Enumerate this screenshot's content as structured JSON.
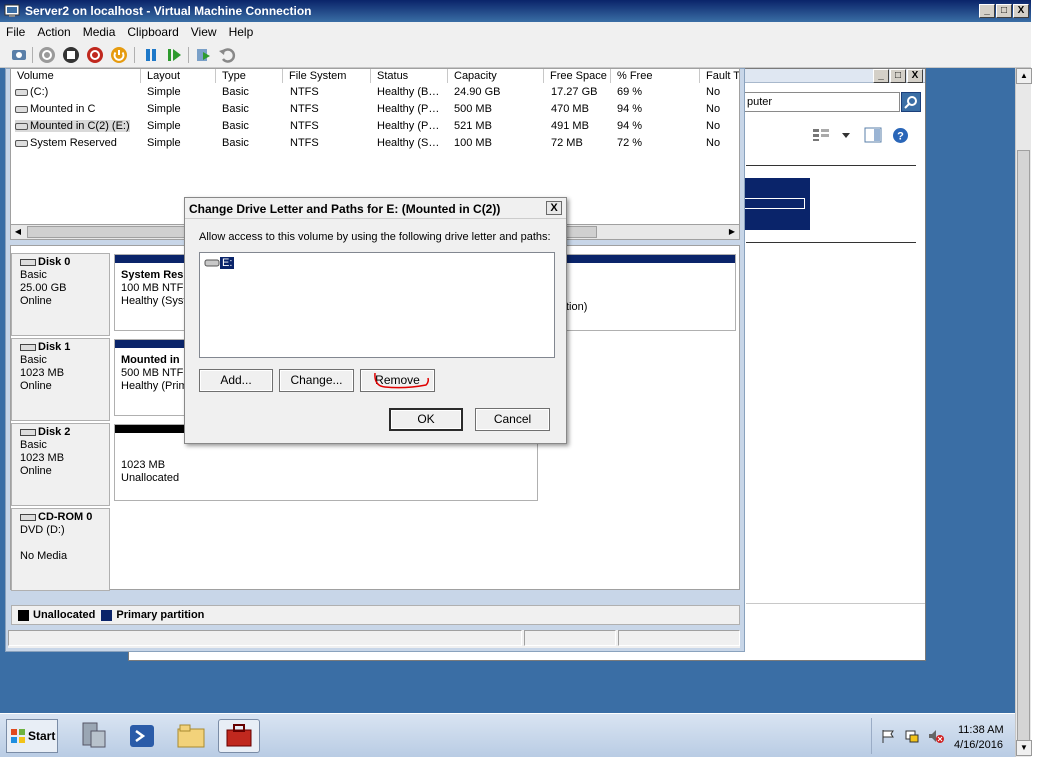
{
  "vm_window": {
    "title": "Server2 on localhost - Virtual Machine Connection",
    "menu": [
      "File",
      "Action",
      "Media",
      "Clipboard",
      "View",
      "Help"
    ],
    "caption_buttons": [
      "_",
      "□",
      "X"
    ]
  },
  "volume_list": {
    "columns": [
      "Volume",
      "Layout",
      "Type",
      "File System",
      "Status",
      "Capacity",
      "Free Space",
      "% Free",
      "Fault T"
    ],
    "rows": [
      [
        "(C:)",
        "Simple",
        "Basic",
        "NTFS",
        "Healthy (B…",
        "24.90 GB",
        "17.27 GB",
        "69 %",
        "No"
      ],
      [
        "Mounted in C",
        "Simple",
        "Basic",
        "NTFS",
        "Healthy (P…",
        "500 MB",
        "470 MB",
        "94 %",
        "No"
      ],
      [
        "Mounted in C(2) (E:)",
        "Simple",
        "Basic",
        "NTFS",
        "Healthy (P…",
        "521 MB",
        "491 MB",
        "94 %",
        "No"
      ],
      [
        "System Reserved",
        "Simple",
        "Basic",
        "NTFS",
        "Healthy (S…",
        "100 MB",
        "72 MB",
        "72 %",
        "No"
      ]
    ]
  },
  "disks": [
    {
      "name": "Disk 0",
      "type": "Basic",
      "size": "25.00 GB",
      "state": "Online",
      "partition_name": "System Res",
      "partition_size": "100 MB NTFS",
      "partition_status": "Healthy (Syst",
      "right_text": "tion)"
    },
    {
      "name": "Disk 1",
      "type": "Basic",
      "size": "1023 MB",
      "state": "Online",
      "partition_name": "Mounted in",
      "partition_size": "500 MB NTFS",
      "partition_status": "Healthy (Prim"
    },
    {
      "name": "Disk 2",
      "type": "Basic",
      "size": "1023 MB",
      "state": "Online",
      "partition_size": "1023 MB",
      "partition_status": "Unallocated"
    },
    {
      "name": "CD-ROM 0",
      "type": "DVD (D:)",
      "state": "No Media"
    }
  ],
  "legend": {
    "unallocated": "Unallocated",
    "primary": "Primary partition"
  },
  "cm_window": {
    "search_text": "puter",
    "caption_buttons": [
      "_",
      "□",
      "X"
    ]
  },
  "dialog": {
    "title": "Change Drive Letter and Paths for E: (Mounted in C(2))",
    "description": "Allow access to this volume by using the following drive letter and paths:",
    "list_items": [
      "E:"
    ],
    "buttons": {
      "add": "Add...",
      "change": "Change...",
      "remove": "Remove",
      "ok": "OK",
      "cancel": "Cancel"
    },
    "close": "X"
  },
  "taskbar": {
    "start": "Start",
    "time": "11:38 AM",
    "date": "4/16/2016"
  },
  "colors": {
    "primary_partition": "#0a246a",
    "unallocated": "#000000",
    "annotation": "#e00000",
    "desktop": "#3a6ea5"
  }
}
